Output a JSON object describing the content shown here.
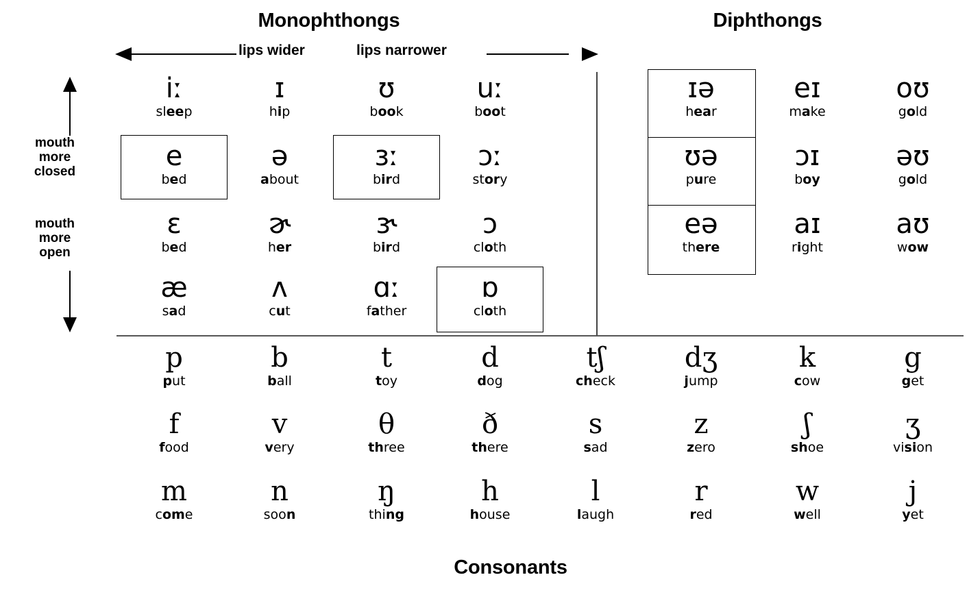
{
  "headings": {
    "monophthongs": "Monophthongs",
    "diphthongs": "Diphthongs",
    "consonants": "Consonants"
  },
  "axes": {
    "lips_wider": "lips wider",
    "lips_narrower": "lips narrower",
    "mouth_more_closed": "mouth\nmore\nclosed",
    "mouth_more_open": "mouth\nmore\nopen",
    "mouth_closed_line1": "mouth",
    "mouth_closed_line2": "more",
    "mouth_closed_line3": "closed",
    "mouth_open_line1": "mouth",
    "mouth_open_line2": "more",
    "mouth_open_line3": "open"
  },
  "monophthongs": {
    "rows": [
      [
        {
          "symbol": "iː",
          "word_pre": "sl",
          "word_bold": "ee",
          "word_post": "p",
          "boxed": false
        },
        {
          "symbol": "ɪ",
          "word_pre": "h",
          "word_bold": "i",
          "word_post": "p",
          "boxed": false
        },
        {
          "symbol": "ʊ",
          "word_pre": "b",
          "word_bold": "oo",
          "word_post": "k",
          "boxed": false
        },
        {
          "symbol": "uː",
          "word_pre": "b",
          "word_bold": "oo",
          "word_post": "t",
          "boxed": false
        }
      ],
      [
        {
          "symbol": "e",
          "word_pre": "b",
          "word_bold": "e",
          "word_post": "d",
          "boxed": true
        },
        {
          "symbol": "ə",
          "word_pre": "",
          "word_bold": "a",
          "word_post": "bout",
          "boxed": false
        },
        {
          "symbol": "ɜː",
          "word_pre": "b",
          "word_bold": "ir",
          "word_post": "d",
          "boxed": true
        },
        {
          "symbol": "ɔː",
          "word_pre": "st",
          "word_bold": "or",
          "word_post": "y",
          "boxed": false
        }
      ],
      [
        {
          "symbol": "ɛ",
          "word_pre": "b",
          "word_bold": "e",
          "word_post": "d",
          "boxed": false
        },
        {
          "symbol": "ɚ",
          "word_pre": "h",
          "word_bold": "er",
          "word_post": "",
          "boxed": false
        },
        {
          "symbol": "ɝ",
          "word_pre": "b",
          "word_bold": "ir",
          "word_post": "d",
          "boxed": false
        },
        {
          "symbol": "ɔ",
          "word_pre": "cl",
          "word_bold": "o",
          "word_post": "th",
          "boxed": false
        }
      ],
      [
        {
          "symbol": "æ",
          "word_pre": "s",
          "word_bold": "a",
          "word_post": "d",
          "boxed": false
        },
        {
          "symbol": "ʌ",
          "word_pre": "c",
          "word_bold": "u",
          "word_post": "t",
          "boxed": false
        },
        {
          "symbol": "ɑː",
          "word_pre": "f",
          "word_bold": "a",
          "word_post": "ther",
          "boxed": false
        },
        {
          "symbol": "ɒ",
          "word_pre": "cl",
          "word_bold": "o",
          "word_post": "th",
          "boxed": true
        }
      ]
    ]
  },
  "diphthongs": {
    "rows": [
      [
        {
          "symbol": "ɪə",
          "word_pre": "h",
          "word_bold": "ea",
          "word_post": "r",
          "boxed": true
        },
        {
          "symbol": "eɪ",
          "word_pre": "m",
          "word_bold": "a",
          "word_post": "ke",
          "boxed": false
        },
        {
          "symbol": "oʊ",
          "word_pre": "g",
          "word_bold": "o",
          "word_post": "ld",
          "boxed": false
        }
      ],
      [
        {
          "symbol": "ʊə",
          "word_pre": "p",
          "word_bold": "u",
          "word_post": "re",
          "boxed": true
        },
        {
          "symbol": "ɔɪ",
          "word_pre": "b",
          "word_bold": "oy",
          "word_post": "",
          "boxed": false
        },
        {
          "symbol": "əʊ",
          "word_pre": "g",
          "word_bold": "o",
          "word_post": "ld",
          "boxed": false
        }
      ],
      [
        {
          "symbol": "eə",
          "word_pre": "th",
          "word_bold": "ere",
          "word_post": "",
          "boxed": true
        },
        {
          "symbol": "aɪ",
          "word_pre": "r",
          "word_bold": "i",
          "word_post": "ght",
          "boxed": false
        },
        {
          "symbol": "aʊ",
          "word_pre": "w",
          "word_bold": "ow",
          "word_post": "",
          "boxed": false
        }
      ]
    ]
  },
  "consonants": {
    "rows": [
      [
        {
          "symbol": "p",
          "word_pre": "",
          "word_bold": "p",
          "word_post": "ut"
        },
        {
          "symbol": "b",
          "word_pre": "",
          "word_bold": "b",
          "word_post": "all"
        },
        {
          "symbol": "t",
          "word_pre": "",
          "word_bold": "t",
          "word_post": "oy"
        },
        {
          "symbol": "d",
          "word_pre": "",
          "word_bold": "d",
          "word_post": "og"
        },
        {
          "symbol": "tʃ",
          "word_pre": "",
          "word_bold": "ch",
          "word_post": "eck"
        },
        {
          "symbol": "dʒ",
          "word_pre": "",
          "word_bold": "j",
          "word_post": "ump"
        },
        {
          "symbol": "k",
          "word_pre": "",
          "word_bold": "c",
          "word_post": "ow"
        },
        {
          "symbol": "g",
          "word_pre": "",
          "word_bold": "g",
          "word_post": "et"
        }
      ],
      [
        {
          "symbol": "f",
          "word_pre": "",
          "word_bold": "f",
          "word_post": "ood"
        },
        {
          "symbol": "v",
          "word_pre": "",
          "word_bold": "v",
          "word_post": "ery"
        },
        {
          "symbol": "θ",
          "word_pre": "",
          "word_bold": "th",
          "word_post": "ree"
        },
        {
          "symbol": "ð",
          "word_pre": "",
          "word_bold": "th",
          "word_post": "ere"
        },
        {
          "symbol": "s",
          "word_pre": "",
          "word_bold": "s",
          "word_post": "ad"
        },
        {
          "symbol": "z",
          "word_pre": "",
          "word_bold": "z",
          "word_post": "ero"
        },
        {
          "symbol": "ʃ",
          "word_pre": "",
          "word_bold": "sh",
          "word_post": "oe"
        },
        {
          "symbol": "ʒ",
          "word_pre": "vi",
          "word_bold": "si",
          "word_post": "on"
        }
      ],
      [
        {
          "symbol": "m",
          "word_pre": "c",
          "word_bold": "om",
          "word_post": "e"
        },
        {
          "symbol": "n",
          "word_pre": "soo",
          "word_bold": "n",
          "word_post": ""
        },
        {
          "symbol": "ŋ",
          "word_pre": "thi",
          "word_bold": "ng",
          "word_post": ""
        },
        {
          "symbol": "h",
          "word_pre": "",
          "word_bold": "h",
          "word_post": "ouse"
        },
        {
          "symbol": "l",
          "word_pre": "",
          "word_bold": "l",
          "word_post": "augh"
        },
        {
          "symbol": "r",
          "word_pre": "",
          "word_bold": "r",
          "word_post": "ed"
        },
        {
          "symbol": "w",
          "word_pre": "",
          "word_bold": "w",
          "word_post": "ell"
        },
        {
          "symbol": "j",
          "word_pre": "",
          "word_bold": "y",
          "word_post": "et"
        }
      ]
    ]
  },
  "colors": {
    "ink": "#000000",
    "background": "#ffffff",
    "rule": "#555555"
  }
}
